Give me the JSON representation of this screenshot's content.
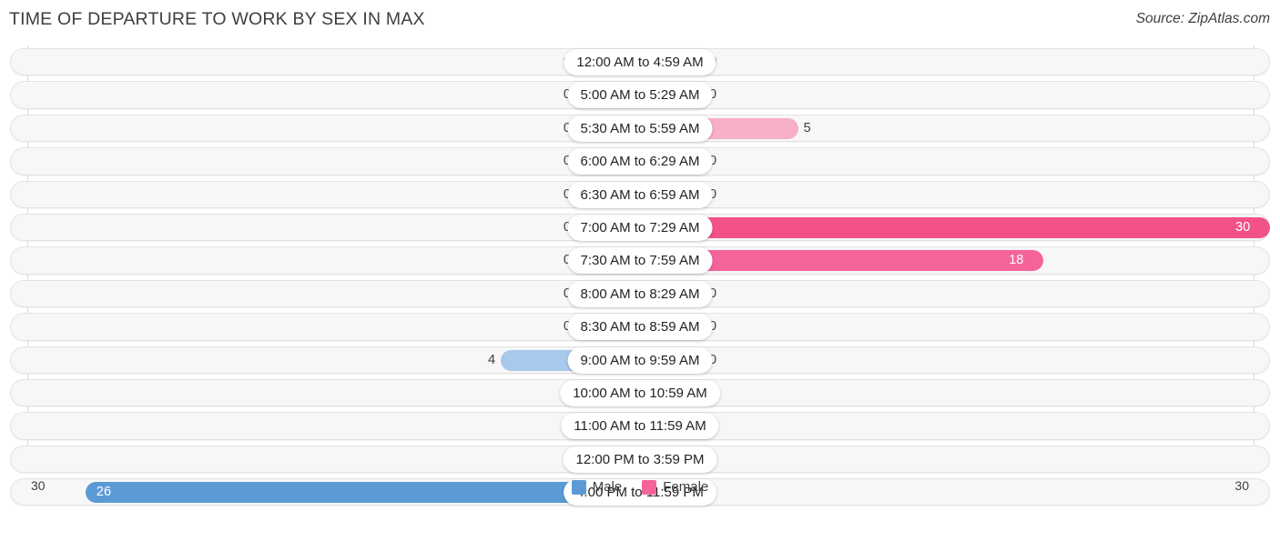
{
  "header": {
    "title": "TIME OF DEPARTURE TO WORK BY SEX IN MAX",
    "source": "Source: ZipAtlas.com"
  },
  "legend": {
    "male_label": "Male",
    "female_label": "Female",
    "male_color": "#5b9bd5",
    "female_color": "#f4649a"
  },
  "axis": {
    "left_label": "30",
    "right_label": "30",
    "max": 30
  },
  "chart_data": {
    "type": "bar",
    "orientation": "horizontal-diverging",
    "title": "TIME OF DEPARTURE TO WORK BY SEX IN MAX",
    "xlabel": "",
    "ylabel": "",
    "xlim": [
      30,
      30
    ],
    "grid": true,
    "legend_position": "bottom-center",
    "categories": [
      "12:00 AM to 4:59 AM",
      "5:00 AM to 5:29 AM",
      "5:30 AM to 5:59 AM",
      "6:00 AM to 6:29 AM",
      "6:30 AM to 6:59 AM",
      "7:00 AM to 7:29 AM",
      "7:30 AM to 7:59 AM",
      "8:00 AM to 8:29 AM",
      "8:30 AM to 8:59 AM",
      "9:00 AM to 9:59 AM",
      "10:00 AM to 10:59 AM",
      "11:00 AM to 11:59 AM",
      "12:00 PM to 3:59 PM",
      "4:00 PM to 11:59 PM"
    ],
    "series": [
      {
        "name": "Male",
        "values": [
          0,
          0,
          0,
          0,
          0,
          0,
          0,
          0,
          0,
          4,
          0,
          0,
          0,
          26
        ]
      },
      {
        "name": "Female",
        "values": [
          0,
          0,
          5,
          0,
          0,
          30,
          18,
          0,
          0,
          0,
          0,
          0,
          0,
          0
        ]
      }
    ]
  },
  "rows": [
    {
      "category": "12:00 AM to 4:59 AM",
      "male": "0",
      "female": "0"
    },
    {
      "category": "5:00 AM to 5:29 AM",
      "male": "0",
      "female": "0"
    },
    {
      "category": "5:30 AM to 5:59 AM",
      "male": "0",
      "female": "5"
    },
    {
      "category": "6:00 AM to 6:29 AM",
      "male": "0",
      "female": "0"
    },
    {
      "category": "6:30 AM to 6:59 AM",
      "male": "0",
      "female": "0"
    },
    {
      "category": "7:00 AM to 7:29 AM",
      "male": "0",
      "female": "30"
    },
    {
      "category": "7:30 AM to 7:59 AM",
      "male": "0",
      "female": "18"
    },
    {
      "category": "8:00 AM to 8:29 AM",
      "male": "0",
      "female": "0"
    },
    {
      "category": "8:30 AM to 8:59 AM",
      "male": "0",
      "female": "0"
    },
    {
      "category": "9:00 AM to 9:59 AM",
      "male": "4",
      "female": "0"
    },
    {
      "category": "10:00 AM to 10:59 AM",
      "male": "0",
      "female": "0"
    },
    {
      "category": "11:00 AM to 11:59 AM",
      "male": "0",
      "female": "0"
    },
    {
      "category": "12:00 PM to 3:59 PM",
      "male": "0",
      "female": "0"
    },
    {
      "category": "4:00 PM to 11:59 PM",
      "male": "26",
      "female": "0"
    }
  ]
}
